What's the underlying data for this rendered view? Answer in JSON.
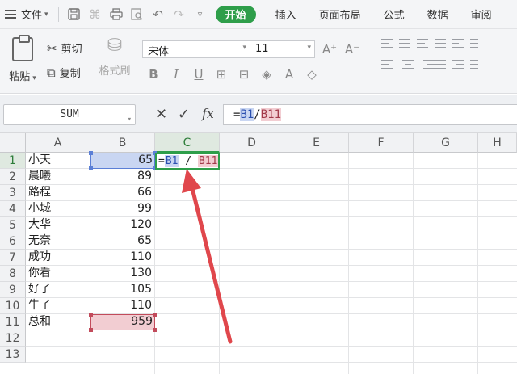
{
  "menubar": {
    "file_label": "文件",
    "tabs": [
      {
        "label": "开始",
        "active": true
      },
      {
        "label": "插入"
      },
      {
        "label": "页面布局"
      },
      {
        "label": "公式"
      },
      {
        "label": "数据"
      },
      {
        "label": "审阅"
      }
    ],
    "quick_icons": [
      "save-icon",
      "format-painter-icon",
      "print-icon",
      "print-preview-icon",
      "undo-icon",
      "redo-icon",
      "customize-icon"
    ]
  },
  "ribbon": {
    "paste_label": "粘贴",
    "cut_label": "剪切",
    "copy_label": "复制",
    "format_painter_label": "格式刷",
    "font_name": "宋体",
    "font_size": "11"
  },
  "formula_bar": {
    "name_box": "SUM",
    "formula_prefix": "=",
    "ref1": "B1",
    "slash": "/",
    "ref2": "B11"
  },
  "sheet": {
    "columns": [
      "A",
      "B",
      "C",
      "D",
      "E",
      "F",
      "G",
      "H"
    ],
    "selected_column": "C",
    "rows": [
      "1",
      "2",
      "3",
      "4",
      "5",
      "6",
      "7",
      "8",
      "9",
      "10",
      "11",
      "12",
      "13"
    ],
    "names": [
      "小天",
      "晨曦",
      "路程",
      "小城",
      "大华",
      "无奈",
      "成功",
      "你看",
      "好了",
      "牛了",
      "总和"
    ],
    "values": [
      "65",
      "89",
      "66",
      "99",
      "120",
      "65",
      "110",
      "130",
      "105",
      "110",
      "959"
    ],
    "c1_edit": {
      "prefix": "=",
      "ref1": "B1",
      "op": " / ",
      "ref2": "B11"
    }
  },
  "colors": {
    "accent_green": "#2e9e4a",
    "ref1_blue": "#c9d6f2",
    "ref2_red": "#f2cdd2",
    "arrow_red": "#e0474c"
  }
}
